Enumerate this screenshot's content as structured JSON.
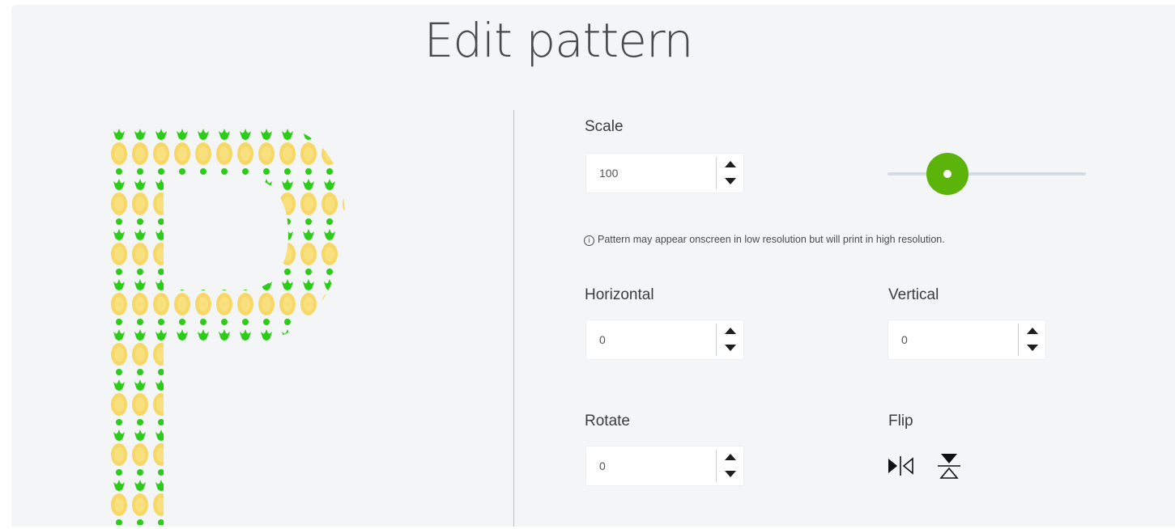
{
  "title": "Edit pattern",
  "scale": {
    "label": "Scale",
    "value": "100",
    "slider_fraction": 0.3
  },
  "note": {
    "icon": "info-icon",
    "text": "Pattern may appear onscreen in low resolution but will print in high resolution."
  },
  "horizontal": {
    "label": "Horizontal",
    "value": "0"
  },
  "vertical": {
    "label": "Vertical",
    "value": "0"
  },
  "rotate": {
    "label": "Rotate",
    "value": "0"
  },
  "flip": {
    "label": "Flip",
    "buttons": [
      "flip-horizontal-icon",
      "flip-vertical-icon"
    ]
  },
  "colors": {
    "accent": "#5cb30a",
    "pattern_leaf": "#2ecc1a",
    "pattern_fruit": "#f7d866"
  }
}
